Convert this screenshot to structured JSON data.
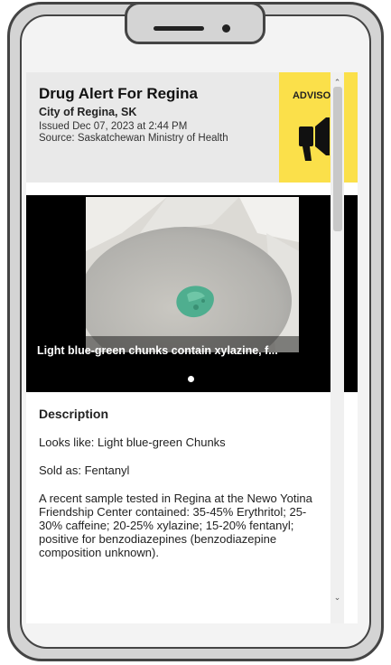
{
  "alert": {
    "title": "Drug Alert For Regina",
    "organization": "City of Regina, SK",
    "issued": "Issued Dec 07, 2023 at 2:44 PM",
    "source": "Source: Saskatchewan Ministry of Health"
  },
  "advisory": {
    "label": "ADVISORY",
    "icon": "megaphone-icon",
    "color": "#fbe04a"
  },
  "gallery": {
    "caption": "Light blue-green chunks contain xylazine, f...",
    "slide_count": 1,
    "active_slide": 1
  },
  "description": {
    "heading": "Description",
    "looks_like": "Looks like: Light blue-green Chunks",
    "sold_as": "Sold as: Fentanyl",
    "body": "A recent sample tested in Regina at the Newo Yotina Friendship Center contained: 35-45% Erythritol; 25-30% caffeine; 20-25% xylazine; 15-20% fentanyl; positive for benzodiazepines (benzodiazepine composition unknown)."
  },
  "scrollbar": {
    "up_icon": "chevron-up-icon",
    "down_icon": "chevron-down-icon"
  }
}
